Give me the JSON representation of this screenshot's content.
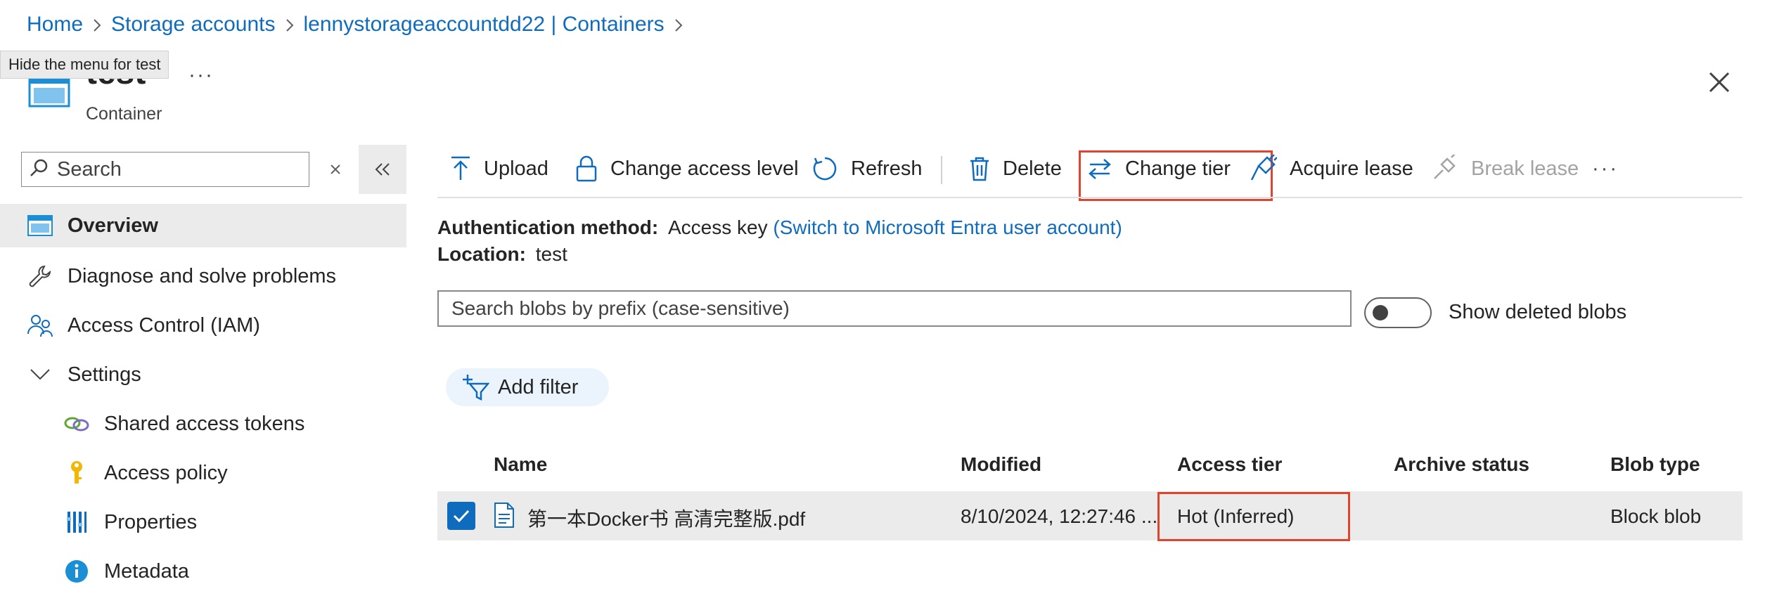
{
  "breadcrumb": {
    "items": [
      "Home",
      "Storage accounts",
      "lennystorageaccountdd22 | Containers"
    ]
  },
  "tooltip": "Hide the menu for test",
  "header": {
    "title": "test",
    "more": "···",
    "subtitle": "Container"
  },
  "sidebar": {
    "search_placeholder": "Search",
    "items": [
      {
        "label": "Overview",
        "icon": "container-icon",
        "selected": true
      },
      {
        "label": "Diagnose and solve problems",
        "icon": "wrench-icon"
      },
      {
        "label": "Access Control (IAM)",
        "icon": "people-icon"
      },
      {
        "label": "Settings",
        "icon": "chevron-down-icon"
      },
      {
        "label": "Shared access tokens",
        "icon": "link-icon"
      },
      {
        "label": "Access policy",
        "icon": "key-icon"
      },
      {
        "label": "Properties",
        "icon": "properties-icon"
      },
      {
        "label": "Metadata",
        "icon": "info-icon"
      }
    ]
  },
  "toolbar": {
    "upload": "Upload",
    "change_access_level": "Change access level",
    "refresh": "Refresh",
    "delete": "Delete",
    "change_tier": "Change tier",
    "acquire_lease": "Acquire lease",
    "break_lease": "Break lease",
    "more": "···"
  },
  "info": {
    "auth_label": "Authentication method:",
    "auth_value": "Access key",
    "auth_switch": "(Switch to Microsoft Entra user account)",
    "location_label": "Location:",
    "location_value": "test"
  },
  "blob_search_placeholder": "Search blobs by prefix (case-sensitive)",
  "show_deleted_label": "Show deleted blobs",
  "add_filter_label": "Add filter",
  "table": {
    "columns": [
      "Name",
      "Modified",
      "Access tier",
      "Archive status",
      "Blob type"
    ],
    "rows": [
      {
        "name": "第一本Docker书 高清完整版.pdf",
        "modified": "8/10/2024, 12:27:46 ...",
        "access_tier": "Hot (Inferred)",
        "archive_status": "",
        "blob_type": "Block blob"
      }
    ]
  },
  "colors": {
    "link": "#0f6cbd",
    "highlight": "#e0442e",
    "selected_bg": "#ebebeb"
  }
}
